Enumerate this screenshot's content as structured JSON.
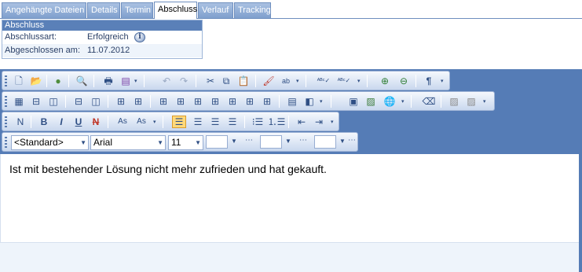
{
  "tabs": [
    {
      "label": "Angehängte Dateien",
      "active": false
    },
    {
      "label": "Details",
      "active": false
    },
    {
      "label": "Termin",
      "active": false
    },
    {
      "label": "Abschluss",
      "active": true
    },
    {
      "label": "Verlauf",
      "active": false
    },
    {
      "label": "Tracking",
      "active": false
    }
  ],
  "panel": {
    "title": "Abschluss",
    "rows": [
      {
        "label": "Abschlussart:",
        "value": "Erfolgreich"
      },
      {
        "label": "Abgeschlossen am:",
        "value": "11.07.2012"
      }
    ],
    "info_icon": "info-icon"
  },
  "toolbars": {
    "style_combo": "<Standard>",
    "font_combo": "Arial",
    "size_combo": "11",
    "buttons": {
      "normal": "N",
      "bold": "B",
      "italic": "I",
      "underline": "U",
      "strike": "N",
      "subscript": "As",
      "superscript": "As"
    }
  },
  "editor": {
    "text": "Ist mit bestehender Lösung nicht mehr zufrieden und hat gekauft."
  },
  "colors": {
    "toolbar_bg": "#557cb6",
    "tab_bg": "#8faad6",
    "panel_header": "#5a80b8"
  }
}
